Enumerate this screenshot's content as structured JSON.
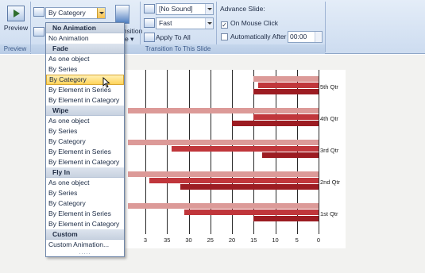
{
  "ribbon": {
    "preview_label": "Preview",
    "preview_group_caption": "Preview",
    "animation_combo_value": "By Category",
    "transition_partial_label_1": "ansition",
    "transition_partial_label_2": "me",
    "sound_value": "[No Sound]",
    "speed_value": "Fast",
    "apply_to_all_label": "Apply To All",
    "advance_slide_label": "Advance Slide:",
    "on_mouse_click_label": "On Mouse Click",
    "on_mouse_click_checked": "✓",
    "automatically_after_label": "Automatically After",
    "automatically_after_value": "00:00",
    "transition_group_caption": "Transition To This Slide"
  },
  "dropdown": {
    "sections": [
      {
        "header": "No Animation",
        "items": [
          "No Animation"
        ]
      },
      {
        "header": "Fade",
        "items": [
          "As one object",
          "By Series",
          "By Category",
          "By Element in Series",
          "By Element in Category"
        ]
      },
      {
        "header": "Wipe",
        "items": [
          "As one object",
          "By Series",
          "By Category",
          "By Element in Series",
          "By Element in Category"
        ]
      },
      {
        "header": "Fly In",
        "items": [
          "As one object",
          "By Series",
          "By Category",
          "By Element in Series",
          "By Element in Category"
        ]
      },
      {
        "header": "Custom",
        "items": [
          "Custom Animation..."
        ]
      }
    ],
    "selected": "Fade / By Category",
    "grip": "....."
  },
  "chart_data": {
    "type": "bar",
    "orientation": "horizontal",
    "x_reversed": true,
    "categories": [
      "1st Qtr",
      "2nd Qtr",
      "3rd Qtr",
      "4th Qtr",
      "5th Qtr"
    ],
    "series": [
      {
        "values": [
          15,
          32,
          13,
          20,
          15
        ],
        "color": "#9c1c22"
      },
      {
        "values": [
          31,
          39,
          34,
          15,
          14
        ],
        "color": "#c0363b"
      },
      {
        "values": [
          44,
          44,
          44,
          44,
          15
        ],
        "color": "#dc9a98"
      }
    ],
    "xticks": [
      "0",
      "5",
      "10",
      "15",
      "20",
      "25",
      "30",
      "35",
      "3"
    ],
    "xlim": [
      0,
      40
    ]
  }
}
